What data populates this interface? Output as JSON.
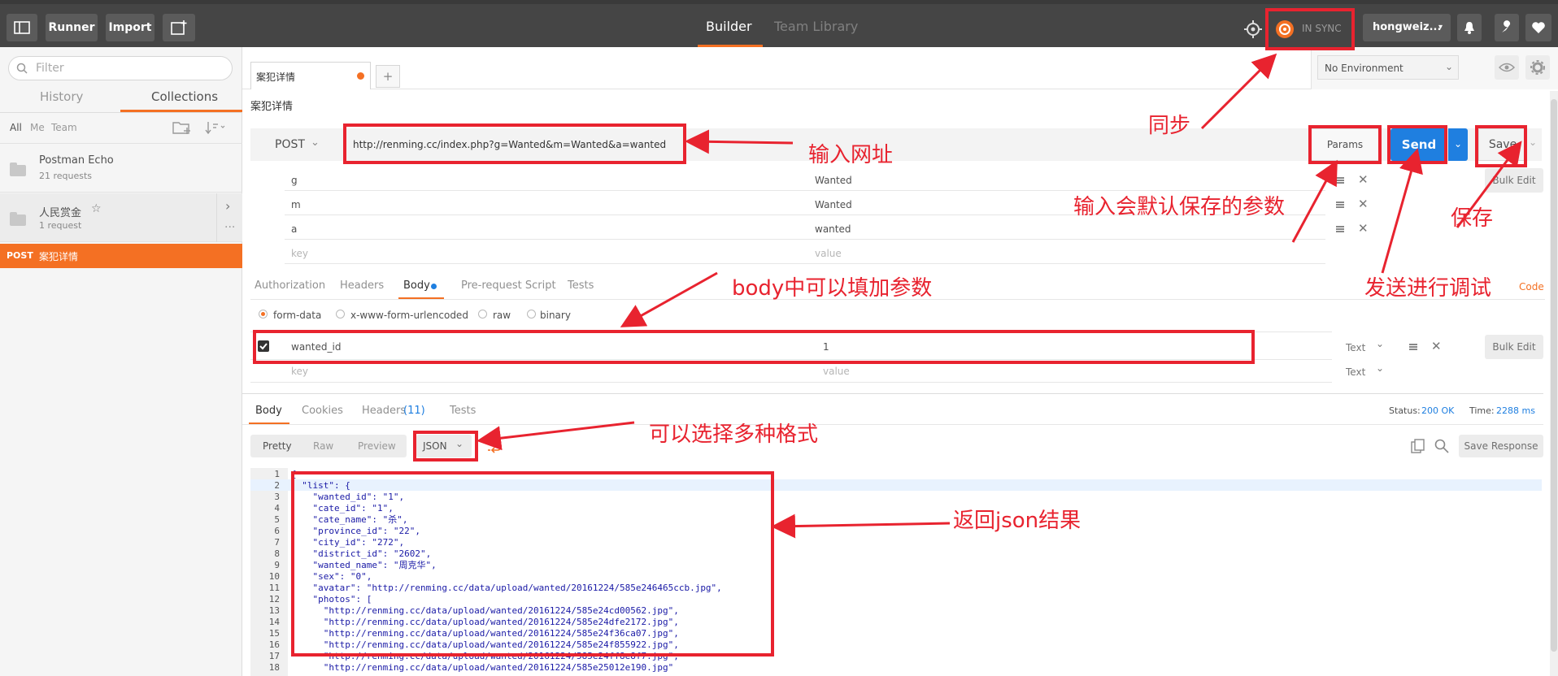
{
  "topbar": {
    "runner": "Runner",
    "import": "Import",
    "tab_builder": "Builder",
    "tab_team_library": "Team Library",
    "sync_status": "IN SYNC",
    "user": "hongweiz..."
  },
  "sidebar": {
    "filter_placeholder": "Filter",
    "tab_history": "History",
    "tab_collections": "Collections",
    "scope_all": "All",
    "scope_me": "Me",
    "scope_team": "Team",
    "collections": [
      {
        "name": "Postman Echo",
        "count": "21 requests"
      },
      {
        "name": "人民赏金",
        "count": "1 request"
      }
    ],
    "active_request": {
      "method": "POST",
      "name": "案犯详情"
    }
  },
  "request_tab": {
    "title": "案犯详情",
    "add": "+"
  },
  "environment": {
    "selected": "No Environment"
  },
  "request": {
    "name": "案犯详情",
    "method": "POST",
    "url": "http://renming.cc/index.php?g=Wanted&m=Wanted&a=wanted",
    "params_label": "Params",
    "send_label": "Send",
    "save_label": "Save",
    "bulk_edit": "Bulk Edit",
    "params": [
      {
        "key": "g",
        "value": "Wanted"
      },
      {
        "key": "m",
        "value": "Wanted"
      },
      {
        "key": "a",
        "value": "wanted"
      }
    ],
    "key_placeholder": "key",
    "value_placeholder": "value",
    "subtabs": [
      "Authorization",
      "Headers",
      "Body",
      "Pre-request Script",
      "Tests"
    ],
    "code_link": "Code",
    "body_modes": [
      "form-data",
      "x-www-form-urlencoded",
      "raw",
      "binary"
    ],
    "body_rows": [
      {
        "key": "wanted_id",
        "value": "1",
        "type": "Text"
      }
    ],
    "type_default": "Text"
  },
  "response": {
    "tabs": [
      "Body",
      "Cookies",
      "Headers",
      "Tests"
    ],
    "headers_count": "(11)",
    "status_label": "Status:",
    "status_value": "200 OK",
    "time_label": "Time:",
    "time_value": "2288 ms",
    "views": [
      "Pretty",
      "Raw",
      "Preview"
    ],
    "format": "JSON",
    "save_response": "Save Response",
    "code_lines": [
      {
        "n": "1",
        "t": "{"
      },
      {
        "n": "2",
        "t": "  \"list\": {"
      },
      {
        "n": "3",
        "t": "    \"wanted_id\": \"1\","
      },
      {
        "n": "4",
        "t": "    \"cate_id\": \"1\","
      },
      {
        "n": "5",
        "t": "    \"cate_name\": \"杀\","
      },
      {
        "n": "6",
        "t": "    \"province_id\": \"22\","
      },
      {
        "n": "7",
        "t": "    \"city_id\": \"272\","
      },
      {
        "n": "8",
        "t": "    \"district_id\": \"2602\","
      },
      {
        "n": "9",
        "t": "    \"wanted_name\": \"周克华\","
      },
      {
        "n": "10",
        "t": "    \"sex\": \"0\","
      },
      {
        "n": "11",
        "t": "    \"avatar\": \"http://renming.cc/data/upload/wanted/20161224/585e246465ccb.jpg\","
      },
      {
        "n": "12",
        "t": "    \"photos\": ["
      },
      {
        "n": "13",
        "t": "      \"http://renming.cc/data/upload/wanted/20161224/585e24cd00562.jpg\","
      },
      {
        "n": "14",
        "t": "      \"http://renming.cc/data/upload/wanted/20161224/585e24dfe2172.jpg\","
      },
      {
        "n": "15",
        "t": "      \"http://renming.cc/data/upload/wanted/20161224/585e24f36ca07.jpg\","
      },
      {
        "n": "16",
        "t": "      \"http://renming.cc/data/upload/wanted/20161224/585e24f855922.jpg\","
      },
      {
        "n": "17",
        "t": "      \"http://renming.cc/data/upload/wanted/20161224/585e24ff8e8f7.jpg\","
      },
      {
        "n": "18",
        "t": "      \"http://renming.cc/data/upload/wanted/20161224/585e25012e190.jpg\""
      }
    ]
  },
  "annotations": {
    "sync": "同步",
    "url": "输入网址",
    "params": "输入会默认保存的参数",
    "save": "保存",
    "send": "发送进行调试",
    "body": "body中可以填加参数",
    "format": "可以选择多种格式",
    "result": "返回json结果"
  },
  "colors": {
    "accent": "#f47023",
    "send": "#1f7fe0",
    "annotation": "#e8232f"
  }
}
